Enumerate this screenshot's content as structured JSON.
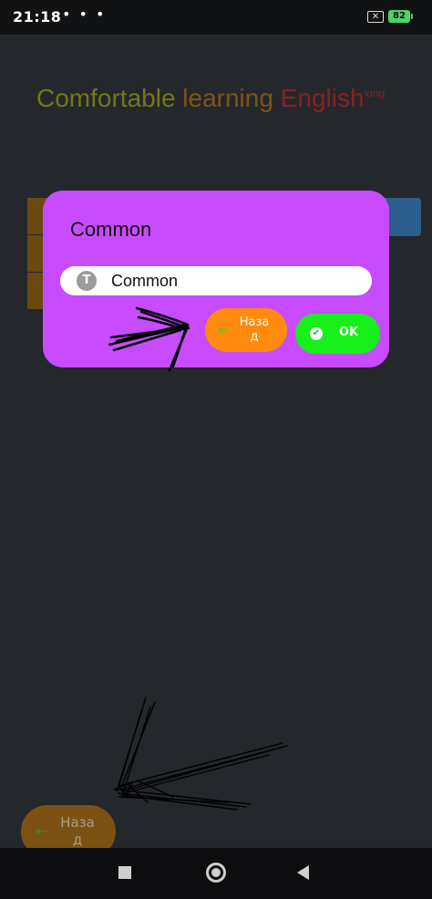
{
  "status_bar": {
    "time": "21:18",
    "more": "• • •",
    "sim_icon": "x-sim-icon",
    "battery": "82"
  },
  "app": {
    "title_words": [
      "Comfortable",
      "learning",
      "English",
      "long"
    ],
    "title_colors": [
      "#d7d700",
      "#f08a00",
      "#ff1b1b",
      "#ff1b1b"
    ]
  },
  "dialog": {
    "title": "Common",
    "field_icon": "T",
    "field_value": "Common",
    "back_label": "Назад",
    "ok_label": "OK",
    "colors": {
      "background": "#c74cff",
      "back": "#ff8a0d",
      "ok": "#17f01b"
    }
  },
  "bottom_back_button": {
    "label": "Назад"
  },
  "nav_bar": {
    "recents": "square-icon",
    "home": "circle-home-icon",
    "back": "triangle-back-icon"
  }
}
